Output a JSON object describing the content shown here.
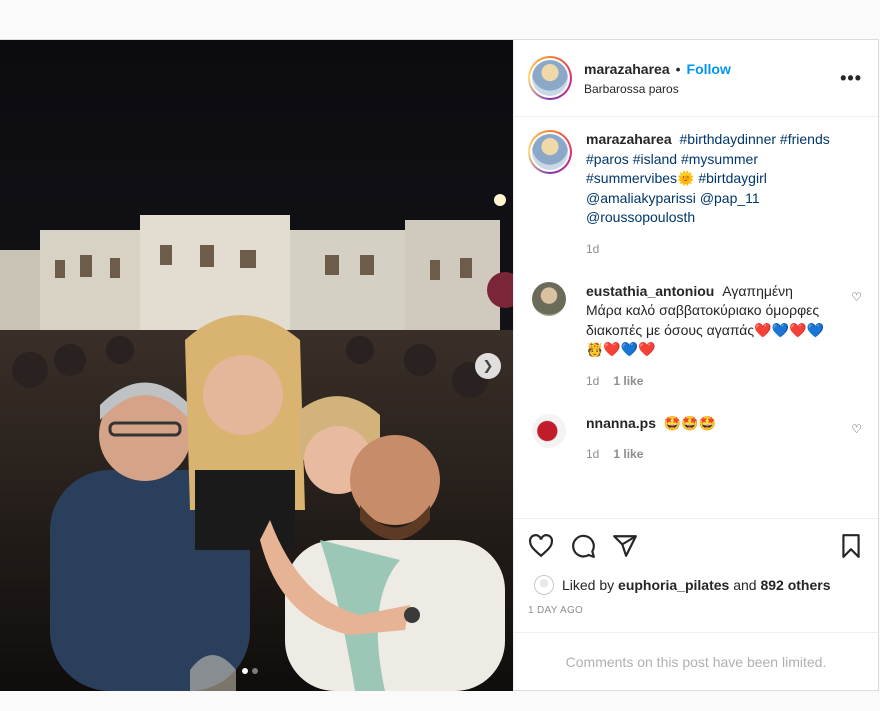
{
  "post": {
    "username": "marazaharea",
    "separator": "•",
    "follow_label": "Follow",
    "location": "Barbarossa paros",
    "more_icon": "more-horizontal-icon",
    "caption": {
      "username": "marazaharea",
      "tags": [
        "#birthdaydinner",
        "#friends",
        "#paros",
        "#island",
        "#mysummer",
        "#summervibes",
        "🌞",
        "#birtdaygirl",
        "@amaliakyparissi",
        "@pap_11",
        "@roussopoulosth"
      ],
      "time": "1d"
    },
    "comments": [
      {
        "username": "eustathia_antoniou",
        "text": "Αγαπημένη Μάρα καλό σαββατοκύριακο όμορφες διακοπές με όσους αγαπάς❤️💙❤️💙🫅❤️💙❤️",
        "time": "1d",
        "likes": "1 like"
      },
      {
        "username": "nnanna.ps",
        "text": "🤩🤩🤩",
        "time": "1d",
        "likes": "1 like"
      }
    ],
    "liked_by_prefix": "Liked by",
    "liked_by_user": "euphoria_pilates",
    "liked_by_suffix": "and",
    "liked_by_others": "892 others",
    "time_ago": "1 DAY AGO",
    "comments_limited": "Comments on this post have been limited.",
    "carousel": {
      "total": 2,
      "current": 1
    },
    "next_icon": "chevron-right-icon"
  }
}
